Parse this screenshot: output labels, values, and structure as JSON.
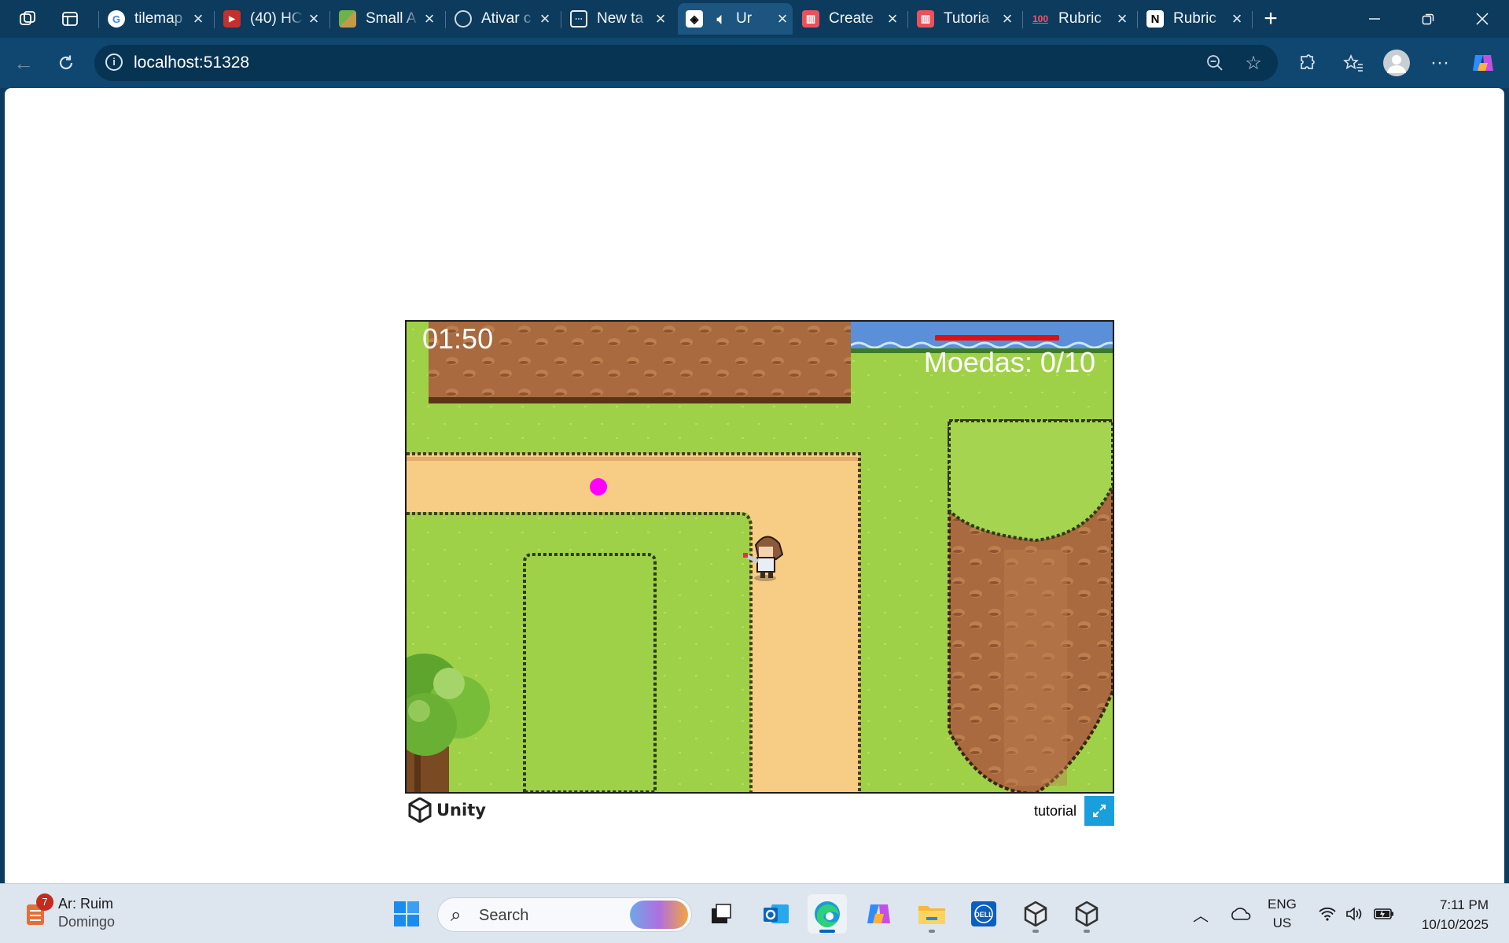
{
  "browser": {
    "tabs": [
      {
        "title": "tilemap",
        "favicon": "google-icon",
        "active": false
      },
      {
        "title": "(40) HC",
        "favicon": "youtube-icon",
        "active": false
      },
      {
        "title": "Small A",
        "favicon": "tileset-icon",
        "active": false
      },
      {
        "title": "Ativar c",
        "favicon": "openai-icon",
        "active": false
      },
      {
        "title": "New ta",
        "favicon": "new-tab-icon",
        "active": false
      },
      {
        "title": "Ur",
        "favicon": "unity-icon",
        "active": true,
        "audio": true
      },
      {
        "title": "Create",
        "favicon": "itch-icon",
        "active": false
      },
      {
        "title": "Tutoria",
        "favicon": "itch-icon",
        "active": false
      },
      {
        "title": "Rubric",
        "favicon": "hundred-icon",
        "active": false
      },
      {
        "title": "Rubric",
        "favicon": "notion-icon",
        "active": false
      }
    ],
    "address": {
      "url": "localhost:51328"
    }
  },
  "game": {
    "timer": "01:50",
    "coins_label": "Moedas: 0/10",
    "health_fraction": 1.0,
    "colors": {
      "grass": "#9fd148",
      "path": "#f7cd86",
      "cliff": "#a86a3e",
      "water": "#5b8fd8",
      "coin": "#ff00ff",
      "health": "#e01010"
    }
  },
  "unity_footer": {
    "brand": "Unity",
    "title": "tutorial",
    "fullscreen_color": "#1a9fdc"
  },
  "taskbar": {
    "weather": {
      "badge": "7",
      "line1": "Ar: Ruim",
      "line2": "Domingo"
    },
    "search_placeholder": "Search",
    "language": {
      "line1": "ENG",
      "line2": "US"
    },
    "clock": {
      "time": "7:11 PM",
      "date": "10/10/2025"
    }
  }
}
